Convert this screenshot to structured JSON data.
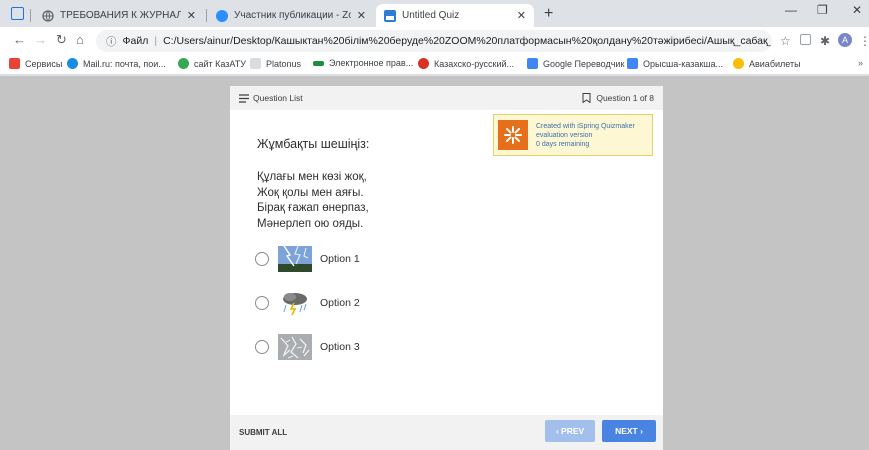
{
  "tabs": [
    {
      "title": "ТРЕБОВАНИЯ К ЖУРНАЛУ — Н...",
      "favicon": "globe-icon"
    },
    {
      "title": "Участник публикации - Zoom",
      "favicon": "zoom-icon"
    },
    {
      "title": "Untitled Quiz",
      "favicon": "ispring-icon"
    }
  ],
  "browser": {
    "address_prefix": "Файл",
    "url": "C:/Users/ainur/Desktop/Кашыктан%20білім%20беруде%20ZOOM%20платформасын%20қолдану%20тәжірибесі/Ашық_сабақ_Адам_жа..."
  },
  "bookmarks": [
    {
      "label": "Сервисы",
      "color": "#ea4335"
    },
    {
      "label": "Mail.ru: почта, пои...",
      "color": "#168de2"
    },
    {
      "label": "сайт КазАТУ",
      "color": "#34a853"
    },
    {
      "label": "Platonus",
      "color": "#9aa0a6"
    },
    {
      "label": "Электронное прав...",
      "color": "#1e8e3e"
    },
    {
      "label": "Казахско-русский...",
      "color": "#d93025"
    },
    {
      "label": "Google Переводчик",
      "color": "#4285f4"
    },
    {
      "label": "Орысша-казакша...",
      "color": "#4285f4"
    },
    {
      "label": "Авиабилеты",
      "color": "#fbbc04"
    }
  ],
  "player": {
    "question_list_label": "Question List",
    "question_counter": "Question 1 of 8",
    "question_title": "Жұмбақты шешіңіз:",
    "riddle_lines": [
      "Құлағы мен көзі жоқ,",
      "Жоқ қолы мен аяғы.",
      "Бірақ ғажап өнерпаз,",
      "Мәнерлеп ою ояды."
    ],
    "options": [
      {
        "label": "Option 1",
        "image": "lightning-image"
      },
      {
        "label": "Option 2",
        "image": "storm-cloud-image"
      },
      {
        "label": "Option 3",
        "image": "frost-pattern-image"
      }
    ],
    "ispring_notice": {
      "line1": "Created with iSpring Quizmaker",
      "line2": "evaluation version",
      "line3": "0 days remaining"
    },
    "submit_all_label": "SUBMIT ALL",
    "prev_label": "‹ PREV",
    "next_label": "NEXT ›"
  }
}
